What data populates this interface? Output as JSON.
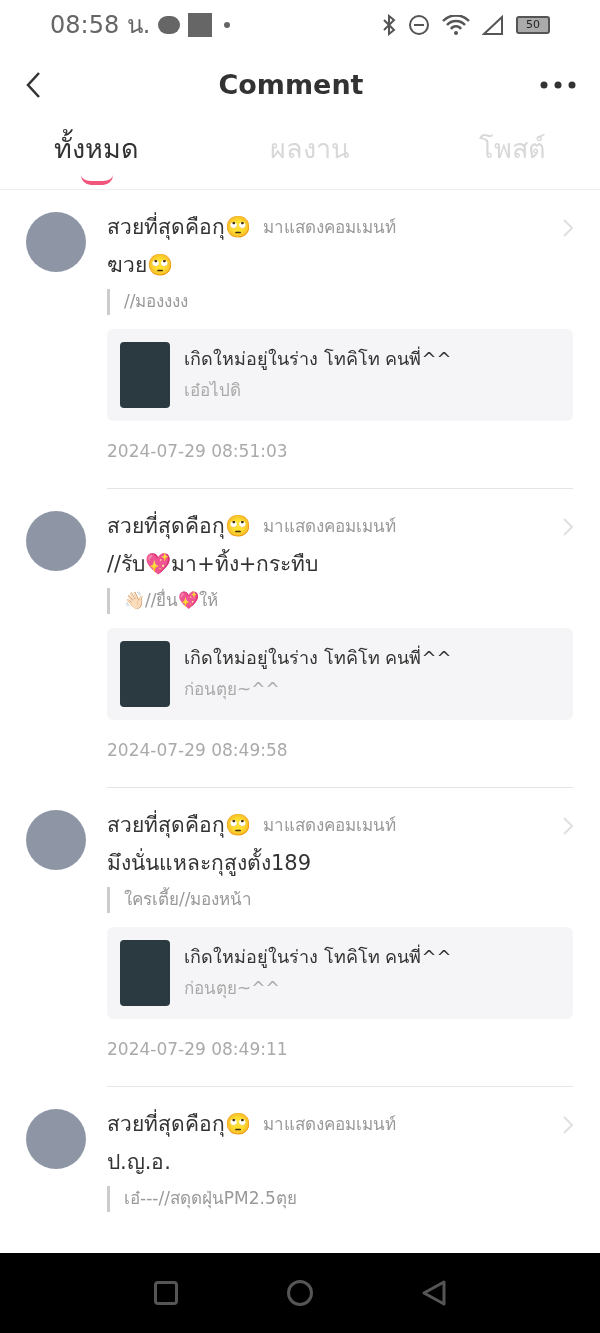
{
  "status_bar": {
    "time": "08:58 น.",
    "battery": "50"
  },
  "header": {
    "title": "Comment"
  },
  "tabs": [
    {
      "label": "ทั้งหมด",
      "selected": true
    },
    {
      "label": "ผลงาน",
      "selected": false
    },
    {
      "label": "โพสต์",
      "selected": false
    }
  ],
  "comments": [
    {
      "author": "สวยที่สุดคือกุ🙄",
      "action": "มาแสดงคอมเมนท์",
      "text": "ฆวย🙄",
      "quote": "//มองงงง",
      "work": {
        "title": "เกิดใหม่อยู่ในร่าง โทคิโท คนพี่^^",
        "excerpt": "เอ๋อไปดิ"
      },
      "time": "2024-07-29 08:51:03"
    },
    {
      "author": "สวยที่สุดคือกุ🙄",
      "action": "มาแสดงคอมเมนท์",
      "text": "//รับ💖มา+ทิ้ง+กระทืบ",
      "quote": "👋🏻//ยื่น💖ให้",
      "work": {
        "title": "เกิดใหม่อยู่ในร่าง โทคิโท คนพี่^^",
        "excerpt": "ก่อนตุย~^^"
      },
      "time": "2024-07-29 08:49:58"
    },
    {
      "author": "สวยที่สุดคือกุ🙄",
      "action": "มาแสดงคอมเมนท์",
      "text": "มึงนั่นแหละกุสูงตั้ง189",
      "quote": "ใครเตี้ย//มองหน้า",
      "work": {
        "title": "เกิดใหม่อยู่ในร่าง โทคิโท คนพี่^^",
        "excerpt": "ก่อนตุย~^^"
      },
      "time": "2024-07-29 08:49:11"
    },
    {
      "author": "สวยที่สุดคือกุ🙄",
      "action": "มาแสดงคอมเมนท์",
      "text": "ป.ญ.อ.",
      "quote": "เอ๋---//สดุดฝุ่นPM2.5ตุย"
    }
  ]
}
